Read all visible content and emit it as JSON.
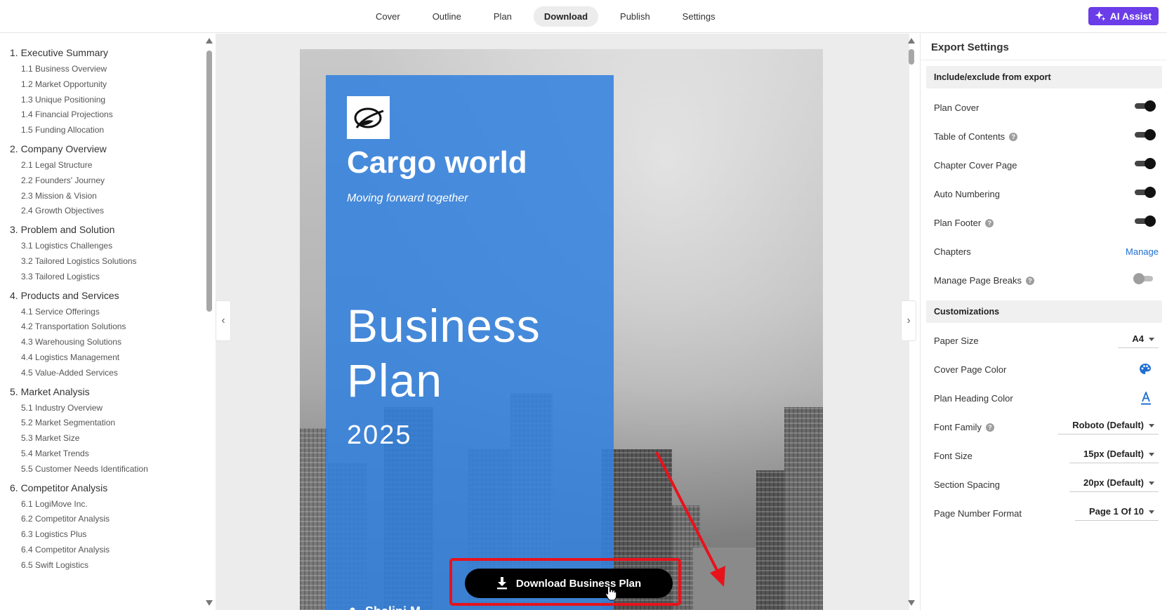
{
  "nav": {
    "tabs": [
      "Cover",
      "Outline",
      "Plan",
      "Download",
      "Publish",
      "Settings"
    ],
    "active_tab": "Download",
    "ai_assist_label": "AI Assist"
  },
  "outline": {
    "chapters": [
      {
        "title": "1. Executive Summary",
        "items": [
          "1.1 Business Overview",
          "1.2 Market Opportunity",
          "1.3 Unique Positioning",
          "1.4 Financial Projections",
          "1.5 Funding Allocation"
        ]
      },
      {
        "title": "2. Company Overview",
        "items": [
          "2.1 Legal Structure",
          "2.2 Founders' Journey",
          "2.3 Mission & Vision",
          "2.4 Growth Objectives"
        ]
      },
      {
        "title": "3. Problem and Solution",
        "items": [
          "3.1 Logistics Challenges",
          "3.2 Tailored Logistics Solutions",
          "3.3 Tailored Logistics"
        ]
      },
      {
        "title": "4. Products and Services",
        "items": [
          "4.1 Service Offerings",
          "4.2 Transportation Solutions",
          "4.3 Warehousing Solutions",
          "4.4 Logistics Management",
          "4.5 Value-Added Services"
        ]
      },
      {
        "title": "5. Market Analysis",
        "items": [
          "5.1 Industry Overview",
          "5.2 Market Segmentation",
          "5.3 Market Size",
          "5.4 Market Trends",
          "5.5 Customer Needs Identification"
        ]
      },
      {
        "title": "6. Competitor Analysis",
        "items": [
          "6.1 LogiMove Inc.",
          "6.2 Competitor Analysis",
          "6.3 Logistics Plus",
          "6.4 Competitor Analysis",
          "6.5 Swift Logistics"
        ]
      }
    ]
  },
  "cover": {
    "company": "Cargo world",
    "tagline": "Moving forward together",
    "title_line1": "Business",
    "title_line2": "Plan",
    "year": "2025",
    "author": "Shalini M",
    "bg_color": "#3482de"
  },
  "download_button_label": "Download Business Plan",
  "panel": {
    "title": "Export Settings",
    "include_section": "Include/exclude from export",
    "include_rows": [
      {
        "label": "Plan Cover",
        "help": false,
        "on": true
      },
      {
        "label": "Table of Contents",
        "help": true,
        "on": true
      },
      {
        "label": "Chapter Cover Page",
        "help": false,
        "on": true
      },
      {
        "label": "Auto Numbering",
        "help": false,
        "on": true
      },
      {
        "label": "Plan Footer",
        "help": true,
        "on": true
      }
    ],
    "chapters_label": "Chapters",
    "manage_label": "Manage",
    "page_breaks_label": "Manage Page Breaks",
    "page_breaks_on": false,
    "custom_section": "Customizations",
    "paper_size_label": "Paper Size",
    "paper_size_value": "A4",
    "cover_color_label": "Cover Page Color",
    "heading_color_label": "Plan Heading Color",
    "font_family_label": "Font Family",
    "font_family_value": "Roboto (Default)",
    "font_size_label": "Font Size",
    "font_size_value": "15px (Default)",
    "section_spacing_label": "Section Spacing",
    "section_spacing_value": "20px (Default)",
    "page_number_label": "Page Number Format",
    "page_number_value": "Page 1 Of 10",
    "accent_color": "#1f6fd4",
    "highlight_color": "#e8121b"
  }
}
